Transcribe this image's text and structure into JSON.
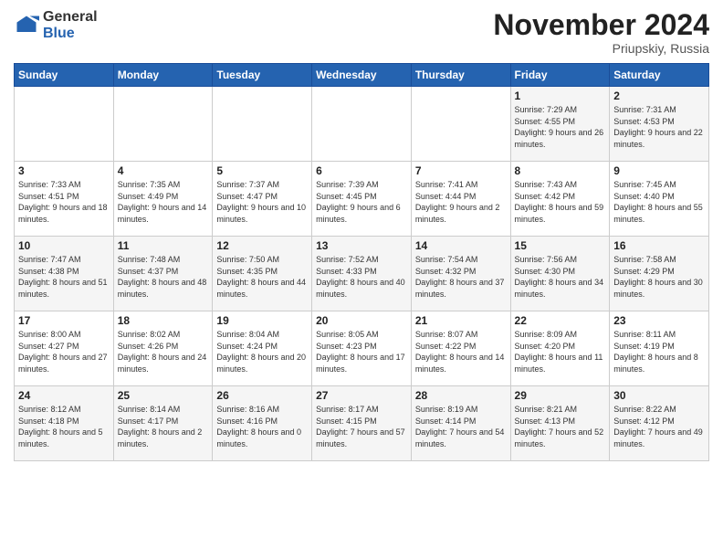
{
  "header": {
    "logo_general": "General",
    "logo_blue": "Blue",
    "title": "November 2024",
    "location": "Priupskiy, Russia"
  },
  "days_of_week": [
    "Sunday",
    "Monday",
    "Tuesday",
    "Wednesday",
    "Thursday",
    "Friday",
    "Saturday"
  ],
  "weeks": [
    [
      {
        "day": "",
        "info": ""
      },
      {
        "day": "",
        "info": ""
      },
      {
        "day": "",
        "info": ""
      },
      {
        "day": "",
        "info": ""
      },
      {
        "day": "",
        "info": ""
      },
      {
        "day": "1",
        "info": "Sunrise: 7:29 AM\nSunset: 4:55 PM\nDaylight: 9 hours and 26 minutes."
      },
      {
        "day": "2",
        "info": "Sunrise: 7:31 AM\nSunset: 4:53 PM\nDaylight: 9 hours and 22 minutes."
      }
    ],
    [
      {
        "day": "3",
        "info": "Sunrise: 7:33 AM\nSunset: 4:51 PM\nDaylight: 9 hours and 18 minutes."
      },
      {
        "day": "4",
        "info": "Sunrise: 7:35 AM\nSunset: 4:49 PM\nDaylight: 9 hours and 14 minutes."
      },
      {
        "day": "5",
        "info": "Sunrise: 7:37 AM\nSunset: 4:47 PM\nDaylight: 9 hours and 10 minutes."
      },
      {
        "day": "6",
        "info": "Sunrise: 7:39 AM\nSunset: 4:45 PM\nDaylight: 9 hours and 6 minutes."
      },
      {
        "day": "7",
        "info": "Sunrise: 7:41 AM\nSunset: 4:44 PM\nDaylight: 9 hours and 2 minutes."
      },
      {
        "day": "8",
        "info": "Sunrise: 7:43 AM\nSunset: 4:42 PM\nDaylight: 8 hours and 59 minutes."
      },
      {
        "day": "9",
        "info": "Sunrise: 7:45 AM\nSunset: 4:40 PM\nDaylight: 8 hours and 55 minutes."
      }
    ],
    [
      {
        "day": "10",
        "info": "Sunrise: 7:47 AM\nSunset: 4:38 PM\nDaylight: 8 hours and 51 minutes."
      },
      {
        "day": "11",
        "info": "Sunrise: 7:48 AM\nSunset: 4:37 PM\nDaylight: 8 hours and 48 minutes."
      },
      {
        "day": "12",
        "info": "Sunrise: 7:50 AM\nSunset: 4:35 PM\nDaylight: 8 hours and 44 minutes."
      },
      {
        "day": "13",
        "info": "Sunrise: 7:52 AM\nSunset: 4:33 PM\nDaylight: 8 hours and 40 minutes."
      },
      {
        "day": "14",
        "info": "Sunrise: 7:54 AM\nSunset: 4:32 PM\nDaylight: 8 hours and 37 minutes."
      },
      {
        "day": "15",
        "info": "Sunrise: 7:56 AM\nSunset: 4:30 PM\nDaylight: 8 hours and 34 minutes."
      },
      {
        "day": "16",
        "info": "Sunrise: 7:58 AM\nSunset: 4:29 PM\nDaylight: 8 hours and 30 minutes."
      }
    ],
    [
      {
        "day": "17",
        "info": "Sunrise: 8:00 AM\nSunset: 4:27 PM\nDaylight: 8 hours and 27 minutes."
      },
      {
        "day": "18",
        "info": "Sunrise: 8:02 AM\nSunset: 4:26 PM\nDaylight: 8 hours and 24 minutes."
      },
      {
        "day": "19",
        "info": "Sunrise: 8:04 AM\nSunset: 4:24 PM\nDaylight: 8 hours and 20 minutes."
      },
      {
        "day": "20",
        "info": "Sunrise: 8:05 AM\nSunset: 4:23 PM\nDaylight: 8 hours and 17 minutes."
      },
      {
        "day": "21",
        "info": "Sunrise: 8:07 AM\nSunset: 4:22 PM\nDaylight: 8 hours and 14 minutes."
      },
      {
        "day": "22",
        "info": "Sunrise: 8:09 AM\nSunset: 4:20 PM\nDaylight: 8 hours and 11 minutes."
      },
      {
        "day": "23",
        "info": "Sunrise: 8:11 AM\nSunset: 4:19 PM\nDaylight: 8 hours and 8 minutes."
      }
    ],
    [
      {
        "day": "24",
        "info": "Sunrise: 8:12 AM\nSunset: 4:18 PM\nDaylight: 8 hours and 5 minutes."
      },
      {
        "day": "25",
        "info": "Sunrise: 8:14 AM\nSunset: 4:17 PM\nDaylight: 8 hours and 2 minutes."
      },
      {
        "day": "26",
        "info": "Sunrise: 8:16 AM\nSunset: 4:16 PM\nDaylight: 8 hours and 0 minutes."
      },
      {
        "day": "27",
        "info": "Sunrise: 8:17 AM\nSunset: 4:15 PM\nDaylight: 7 hours and 57 minutes."
      },
      {
        "day": "28",
        "info": "Sunrise: 8:19 AM\nSunset: 4:14 PM\nDaylight: 7 hours and 54 minutes."
      },
      {
        "day": "29",
        "info": "Sunrise: 8:21 AM\nSunset: 4:13 PM\nDaylight: 7 hours and 52 minutes."
      },
      {
        "day": "30",
        "info": "Sunrise: 8:22 AM\nSunset: 4:12 PM\nDaylight: 7 hours and 49 minutes."
      }
    ]
  ]
}
